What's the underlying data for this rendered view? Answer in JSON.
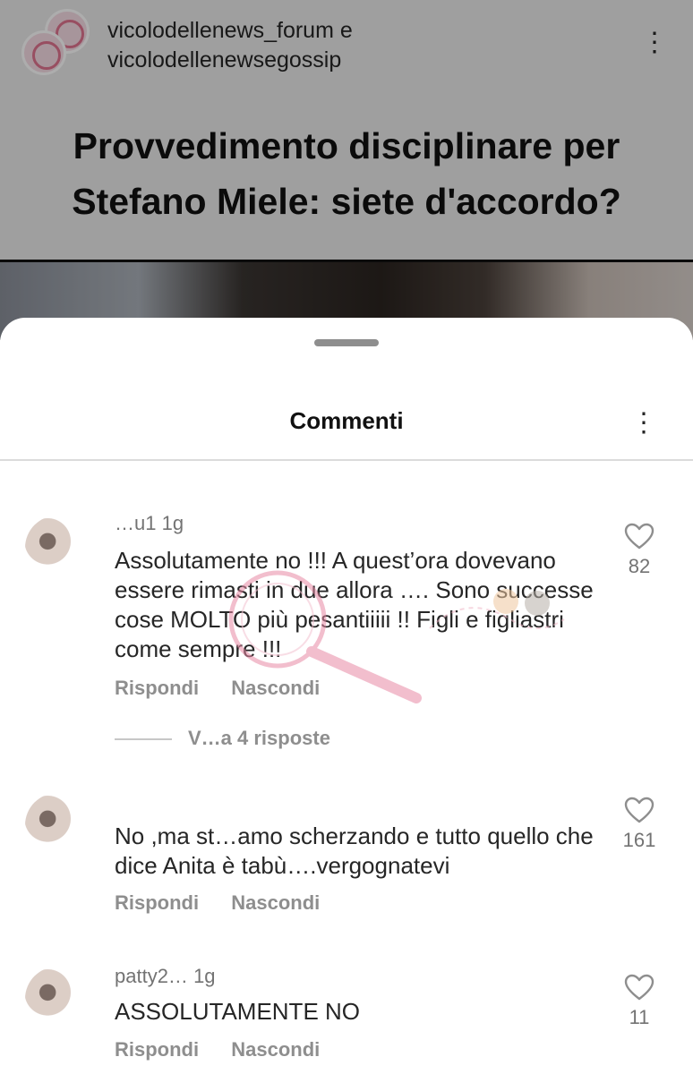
{
  "post": {
    "account_line1": "vicolodellenews_forum e",
    "account_line2": "vicolodellenewsegossip",
    "title_line1": "Provvedimento disciplinare per",
    "title_line2": "Stefano Miele: siete d'accordo?"
  },
  "sheet": {
    "title": "Commenti"
  },
  "comments": [
    {
      "user": "…u1",
      "time": "1g",
      "text": "Assolutamente no !!! A quest’ora dovevano essere rimasti in due allora …. Sono successe cose MOLTO più pesantiiiii !! Figli e figliastri come sempre !!!",
      "reply_label": "Rispondi",
      "hide_label": "Nascondi",
      "likes": "82",
      "view_replies": "V…a 4 risposte"
    },
    {
      "user": "",
      "time": "",
      "text": "No ,ma st…amo scherzando e tutto quello che dice Anita è tabù….vergognatevi",
      "reply_label": "Rispondi",
      "hide_label": "Nascondi",
      "likes": "161"
    },
    {
      "user": "patty2…",
      "time": "1g",
      "text": "ASSOLUTAMENTE NO",
      "reply_label": "Rispondi",
      "hide_label": "Nascondi",
      "likes": "11"
    }
  ],
  "icons": {
    "more": "more-vertical-icon",
    "like": "heart-icon"
  },
  "colors": {
    "text": "#262626",
    "secondary": "#737373",
    "action": "#8e8e8e"
  }
}
